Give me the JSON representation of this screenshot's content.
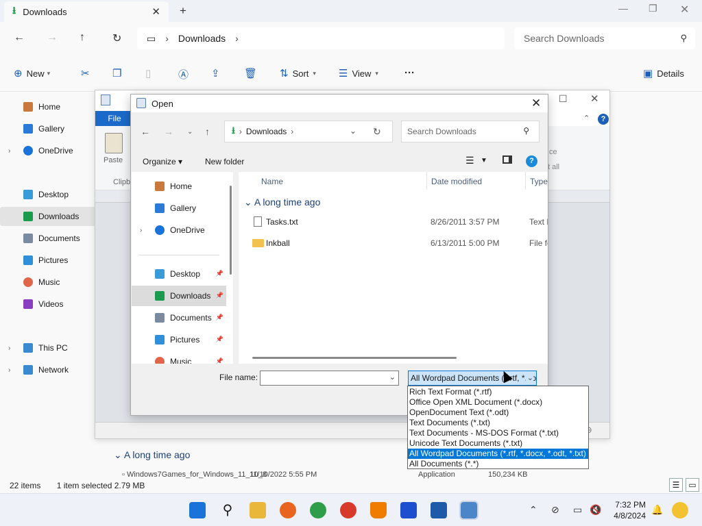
{
  "explorer": {
    "tab_title": "Downloads",
    "address": "Downloads",
    "search_placeholder": "Search Downloads",
    "toolbar": {
      "new": "New",
      "sort": "Sort",
      "view": "View",
      "more": "···",
      "details": "Details"
    },
    "sidebar": [
      {
        "label": "Home",
        "color": "#c9793b"
      },
      {
        "label": "Gallery",
        "color": "#2a7ad8"
      },
      {
        "label": "OneDrive",
        "color": "#1a73d9"
      },
      {
        "label": "Desktop",
        "color": "#3a9bd9"
      },
      {
        "label": "Downloads",
        "color": "#1a9b4b"
      },
      {
        "label": "Documents",
        "color": "#7a8aa0"
      },
      {
        "label": "Pictures",
        "color": "#2f8fd8"
      },
      {
        "label": "Music",
        "color": "#e0664a"
      },
      {
        "label": "Videos",
        "color": "#8a3fc0"
      },
      {
        "label": "This PC",
        "color": "#3a8ad0"
      },
      {
        "label": "Network",
        "color": "#3a8ad0"
      }
    ],
    "main_group": "A long time ago",
    "main_row": {
      "name": "Windows7Games_for_Windows_11_10_8",
      "date": "11/10/2022 5:55 PM",
      "type": "Application",
      "size": "150,234 KB"
    },
    "status": {
      "items": "22 items",
      "selected": "1 item selected  2.79 MB"
    }
  },
  "wordpad": {
    "file_tab": "File",
    "paste": "Paste",
    "clipboard": "Clipb",
    "replace_fragment": "ce",
    "select_all_fragment": "t all"
  },
  "dialog": {
    "title": "Open",
    "address": "Downloads",
    "search_placeholder": "Search Downloads",
    "organize": "Organize",
    "new_folder": "New folder",
    "help": "?",
    "nav": [
      {
        "label": "Home",
        "color": "#c9793b",
        "pinned": false
      },
      {
        "label": "Gallery",
        "color": "#2a7ad8",
        "pinned": false
      },
      {
        "label": "OneDrive",
        "color": "#1a73d9",
        "pinned": false
      },
      {
        "label": "Desktop",
        "color": "#3a9bd9",
        "pinned": true
      },
      {
        "label": "Downloads",
        "color": "#1a9b4b",
        "pinned": true
      },
      {
        "label": "Documents",
        "color": "#7a8aa0",
        "pinned": true
      },
      {
        "label": "Pictures",
        "color": "#2f8fd8",
        "pinned": true
      },
      {
        "label": "Music",
        "color": "#e0664a",
        "pinned": true
      }
    ],
    "columns": {
      "name": "Name",
      "date": "Date modified",
      "type": "Type"
    },
    "group": "A long time ago",
    "files": [
      {
        "name": "Tasks.txt",
        "date": "8/26/2011 3:57 PM",
        "type": "Text D",
        "icon": "text-file-icon"
      },
      {
        "name": "Inkball",
        "date": "6/13/2011 5:00 PM",
        "type": "File fo",
        "icon": "folder-icon"
      }
    ],
    "file_name_label": "File name:",
    "file_name_value": "",
    "file_type_selected": "All Wordpad Documents (*.rtf, *.docx, *.odt, *.txt)",
    "file_type_options": [
      "Rich Text Format (*.rtf)",
      "Office Open XML Document (*.docx)",
      "OpenDocument Text (*.odt)",
      "Text Documents (*.txt)",
      "Text Documents - MS-DOS Format (*.txt)",
      "Unicode Text Documents (*.txt)",
      "All Wordpad Documents (*.rtf, *.docx, *.odt, *.txt)",
      "All Documents (*.*)"
    ],
    "selected_option_index": 6
  },
  "taskbar": {
    "time": "7:32 PM",
    "date": "4/8/2024",
    "apps": [
      {
        "name": "start-button",
        "color": "#1a73d9"
      },
      {
        "name": "search-button",
        "color": "#222222"
      },
      {
        "name": "file-explorer-app",
        "color": "#e9b73a"
      },
      {
        "name": "firefox-app",
        "color": "#e8641f"
      },
      {
        "name": "chrome-app",
        "color": "#2e9e4a"
      },
      {
        "name": "ccleaner-app",
        "color": "#d83a2a"
      },
      {
        "name": "vlc-app",
        "color": "#f07d00"
      },
      {
        "name": "malwarebytes-app",
        "color": "#1c4fd0"
      },
      {
        "name": "virtualbox-app",
        "color": "#1d5aa8"
      },
      {
        "name": "wordpad-app",
        "color": "#4a86c8"
      }
    ]
  }
}
